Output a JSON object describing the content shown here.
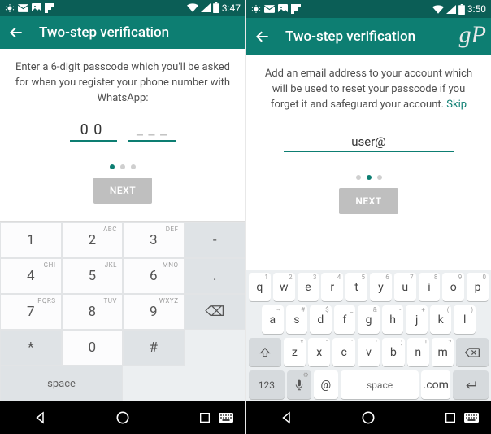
{
  "left": {
    "status": {
      "time": "3:47"
    },
    "appbar": {
      "title": "Two-step verification"
    },
    "instruction": "Enter a 6-digit passcode which you'll be asked for when you register your phone number with WhatsApp:",
    "pass_group1": "0 0",
    "pass_group2": "_  _  _",
    "dots_active_index": 0,
    "next_label": "NEXT",
    "keypad": {
      "r1": [
        {
          "main": "1",
          "sub": ""
        },
        {
          "main": "2",
          "sub": "ABC"
        },
        {
          "main": "3",
          "sub": "DEF"
        },
        {
          "main": "-",
          "sub": "",
          "dark": true
        }
      ],
      "r2": [
        {
          "main": "4",
          "sub": "GHI"
        },
        {
          "main": "5",
          "sub": "JKL"
        },
        {
          "main": "6",
          "sub": "MNO"
        },
        {
          "main": ".",
          "sub": "",
          "dark": true
        }
      ],
      "r3": [
        {
          "main": "7",
          "sub": "PQRS"
        },
        {
          "main": "8",
          "sub": "TUV"
        },
        {
          "main": "9",
          "sub": "WXYZ"
        },
        {
          "main": "⌫",
          "sub": "",
          "dark": true
        }
      ],
      "r4": [
        {
          "main": "*",
          "sub": "",
          "dark": true
        },
        {
          "main": "0",
          "sub": ""
        },
        {
          "main": "#",
          "sub": "",
          "dark": true
        },
        {
          "main": "space",
          "sub": "",
          "dark": true,
          "space": true
        }
      ]
    }
  },
  "right": {
    "status": {
      "time": "3:50"
    },
    "appbar": {
      "title": "Two-step verification"
    },
    "instruction_prefix": "Add an email address to your account which will be used to reset your passcode if you forget it and safeguard your account. ",
    "skip_label": "Skip",
    "email_value": "user@",
    "dots_active_index": 1,
    "next_label": "NEXT",
    "qwerty": {
      "row1": [
        {
          "k": "q",
          "s": "1"
        },
        {
          "k": "w",
          "s": "2"
        },
        {
          "k": "e",
          "s": "3"
        },
        {
          "k": "r",
          "s": "4"
        },
        {
          "k": "t",
          "s": "5"
        },
        {
          "k": "y",
          "s": "6"
        },
        {
          "k": "u",
          "s": "7"
        },
        {
          "k": "i",
          "s": "8"
        },
        {
          "k": "o",
          "s": "9"
        },
        {
          "k": "p",
          "s": "0"
        }
      ],
      "row2": [
        {
          "k": "a",
          "s": "~"
        },
        {
          "k": "s",
          "s": "#"
        },
        {
          "k": "d",
          "s": "$"
        },
        {
          "k": "f",
          "s": "_"
        },
        {
          "k": "g",
          "s": "&"
        },
        {
          "k": "h",
          "s": "-"
        },
        {
          "k": "j",
          "s": "+"
        },
        {
          "k": "k",
          "s": "("
        },
        {
          "k": "l",
          "s": ")"
        }
      ],
      "row3": [
        {
          "k": "z",
          "s": "*"
        },
        {
          "k": "x",
          "s": "\""
        },
        {
          "k": "c",
          "s": "'"
        },
        {
          "k": "v",
          "s": ":"
        },
        {
          "k": "b",
          "s": ";"
        },
        {
          "k": "n",
          "s": "!"
        },
        {
          "k": "m",
          "s": "?"
        }
      ],
      "fn": {
        "num": "123",
        "at": "@",
        "space": "space",
        "com": ".com"
      }
    }
  },
  "watermark": "gP"
}
